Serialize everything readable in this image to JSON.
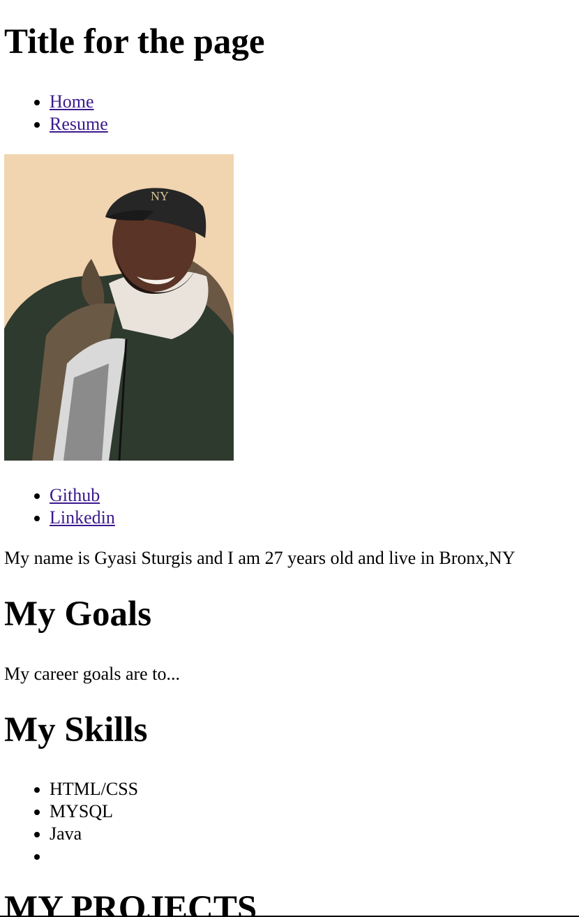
{
  "page": {
    "title": "Title for the page"
  },
  "nav": {
    "items": [
      {
        "label": "Home"
      },
      {
        "label": "Resume"
      }
    ]
  },
  "profile": {
    "photo_icon": "portrait-photo",
    "colors": {
      "wall": "#f3d7b4",
      "jacket": "#2f3a2e",
      "skin": "#5a3426",
      "cap": "#262626",
      "hoodie": "#e9e3dc"
    }
  },
  "social": {
    "links": [
      {
        "label": "Github"
      },
      {
        "label": "Linkedin"
      }
    ]
  },
  "about": {
    "intro": "My name is Gyasi Sturgis and I am 27 years old and live in Bronx,NY"
  },
  "goals": {
    "heading": "My Goals",
    "text": "My career goals are to..."
  },
  "skills": {
    "heading": "My Skills",
    "items": [
      {
        "label": "HTML/CSS"
      },
      {
        "label": "MYSQL"
      },
      {
        "label": "Java"
      },
      {
        "label": ""
      }
    ]
  },
  "projects": {
    "heading": "MY PROJECTS"
  },
  "colors": {
    "link": "#3b1a8c",
    "text": "#000000",
    "background": "#ffffff"
  }
}
